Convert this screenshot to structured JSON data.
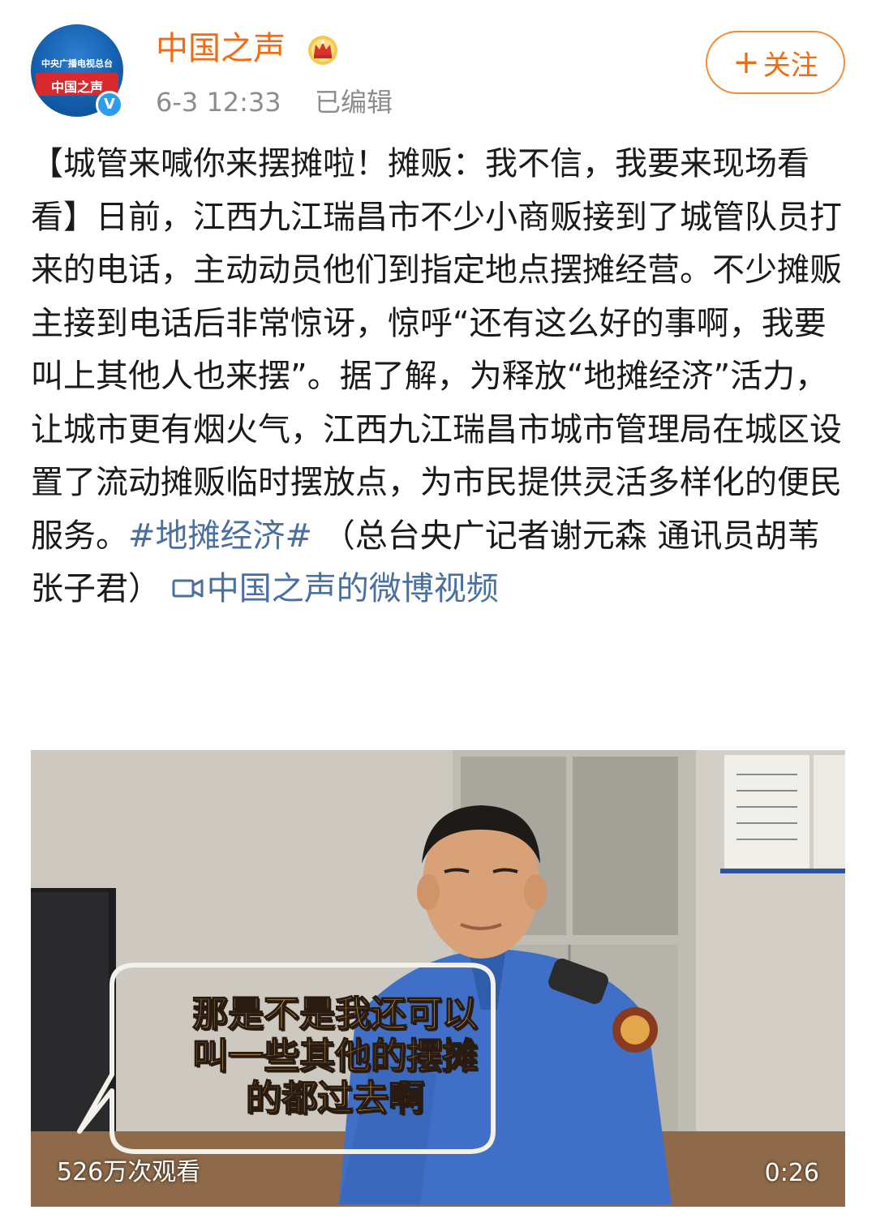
{
  "user": {
    "name": "中国之声",
    "avatar_top_text": "中央广播电视总台",
    "avatar_banner_text": "中国之声",
    "timestamp": "6-3 12:33",
    "edited_label": "已编辑",
    "verified_mark": "V"
  },
  "follow_button": {
    "plus": "+",
    "label": "关注"
  },
  "post": {
    "text_main": "【城管来喊你来摆摊啦！摊贩：我不信，我要来现场看看】日前，江西九江瑞昌市不少小商贩接到了城管队员打来的电话，主动动员他们到指定地点摆摊经营。不少摊贩主接到电话后非常惊讶，惊呼“还有这么好的事啊，我要叫上其他人也来摆”。据了解，为释放“地摊经济”活力，让城市更有烟火气，江西九江瑞昌市城市管理局在城区设置了流动摊贩临时摆放点，为市民提供灵活多样化的便民服务。",
    "hashtag": "#地摊经济#",
    "credits": " （总台央广记者谢元森 通讯员胡苇 张子君） ",
    "video_link": "中国之声的微博视频"
  },
  "video": {
    "subtitle": "那是不是我还可以\n叫一些其他的摆摊\n的都过去啊",
    "views": "526万次观看",
    "duration": "0:26"
  },
  "colors": {
    "brand_orange": "#f16b14",
    "link_blue": "#4a6fa1",
    "meta_gray": "#8c8c8c"
  }
}
